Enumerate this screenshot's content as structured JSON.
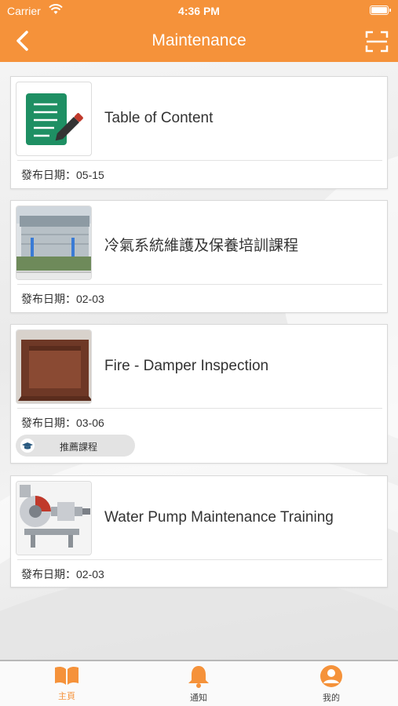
{
  "status_bar": {
    "carrier": "Carrier",
    "time": "4:36 PM"
  },
  "header": {
    "title": "Maintenance"
  },
  "courses": [
    {
      "title": "Table of Content",
      "date_label": "發布日期：",
      "date": "05-15"
    },
    {
      "title": "冷氣系統維護及保養培訓課程",
      "date_label": "發布日期：",
      "date": "02-03"
    },
    {
      "title": "Fire - Damper Inspection",
      "date_label": "發布日期：",
      "date": "03-06",
      "tag": "推薦課程"
    },
    {
      "title": "Water Pump Maintenance Training",
      "date_label": "發布日期：",
      "date": "02-03"
    }
  ],
  "tabs": [
    {
      "label": "主頁",
      "icon": "book-icon",
      "active": true
    },
    {
      "label": "通知",
      "icon": "bell-icon",
      "active": false
    },
    {
      "label": "我的",
      "icon": "user-icon",
      "active": false
    }
  ],
  "colors": {
    "accent": "#f5923a",
    "tag_bg": "#e3e3e3",
    "document_icon": "#1e8f63"
  }
}
